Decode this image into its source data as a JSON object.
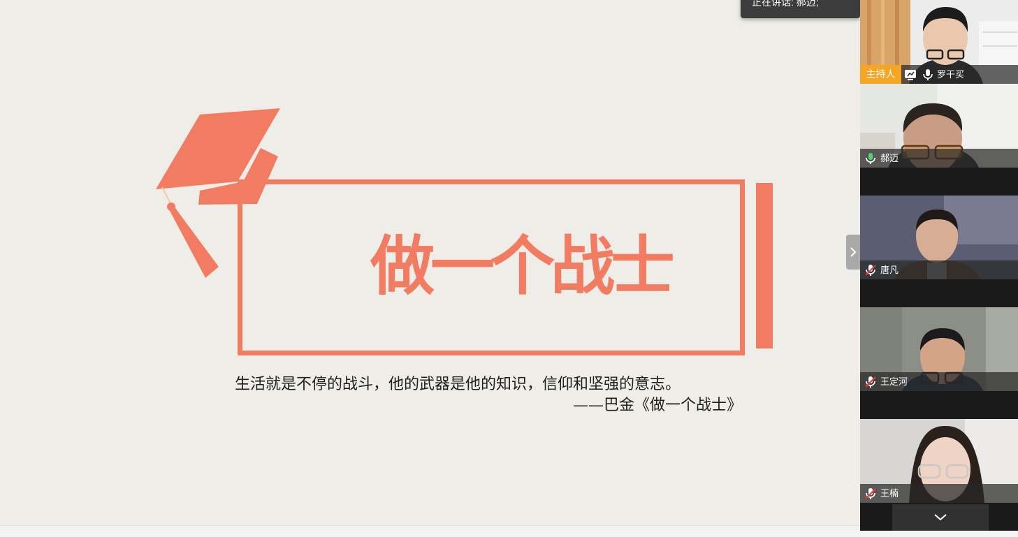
{
  "slide": {
    "title": "做一个战士",
    "quote": "生活就是不停的战斗，他的武器是他的知识，信仰和坚强的意志。",
    "attribution": "——巴金《做一个战士》"
  },
  "speaking_banner": {
    "text": "正在讲话: 郝迈;"
  },
  "participants": [
    {
      "name": "罗干买",
      "role": "主持人",
      "mic": "on",
      "sharing": true
    },
    {
      "name": "郝迈",
      "mic": "speaking"
    },
    {
      "name": "唐凡",
      "mic": "muted"
    },
    {
      "name": "王定河",
      "mic": "muted"
    },
    {
      "name": "王楠",
      "mic": "muted"
    }
  ],
  "colors": {
    "accent": "#f27c62",
    "slide_bg": "#efede8",
    "host_badge": "#f5a623",
    "mic_active": "#4cd964",
    "mic_muted": "#e53935"
  },
  "icons": {
    "collapse_tab": "chevron-right-icon",
    "scroll_down": "chevron-down-icon"
  }
}
